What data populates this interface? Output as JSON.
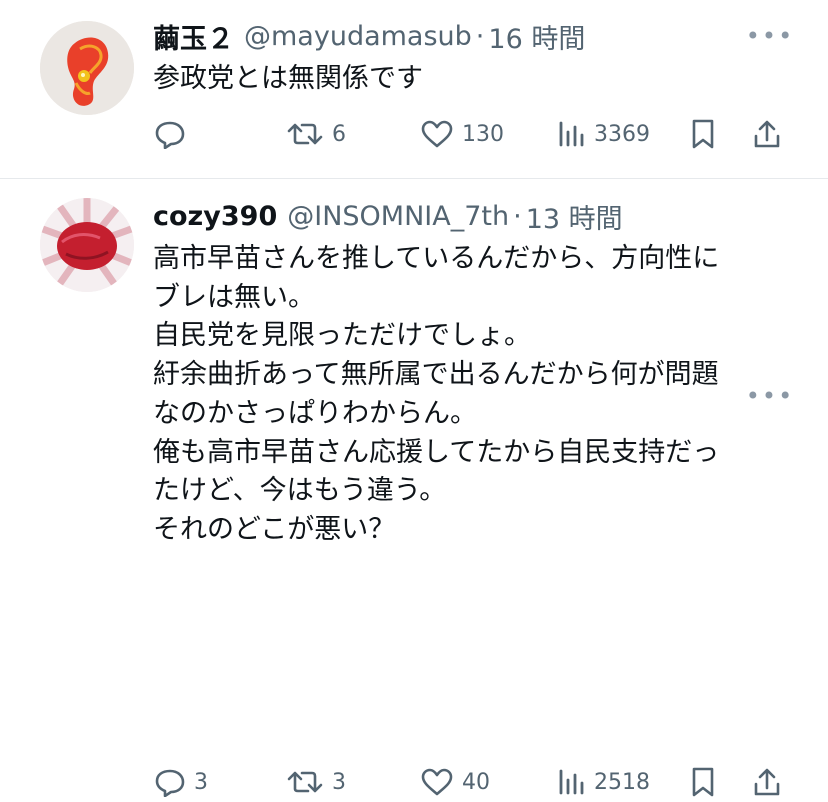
{
  "tweets": [
    {
      "name": "繭玉２",
      "handle": "@mayudamasub",
      "separator": "·",
      "time": "16 時間",
      "more": "•••",
      "lines": [
        "参政党とは無関係です"
      ],
      "actions": {
        "reply": "",
        "retweet": "6",
        "like": "130",
        "views": "3369"
      }
    },
    {
      "name": "cozy390",
      "handle": "@INSOMNIA_7th",
      "separator": "·",
      "time": "13 時間",
      "more": "•••",
      "lines": [
        "高市早苗さんを推しているんだから、方向性に",
        "ブレは無い。",
        "自民党を見限っただけでしょ。",
        "紆余曲折あって無所属で出るんだから何が問題",
        "なのかさっぱりわからん。",
        "俺も高市早苗さん応援してたから自民支持だっ",
        "たけど、今はもう違う。",
        "それのどこが悪い？"
      ],
      "actions": {
        "reply": "3",
        "retweet": "3",
        "like": "40",
        "views": "2518"
      }
    }
  ],
  "icons": {
    "reply": "reply-icon",
    "retweet": "retweet-icon",
    "like": "like-icon",
    "views": "views-icon",
    "bookmark": "bookmark-icon",
    "share": "share-icon",
    "more": "more-icon"
  },
  "colors": {
    "text": "#0f1419",
    "secondary": "#536471",
    "divider": "#e6e9ec"
  }
}
